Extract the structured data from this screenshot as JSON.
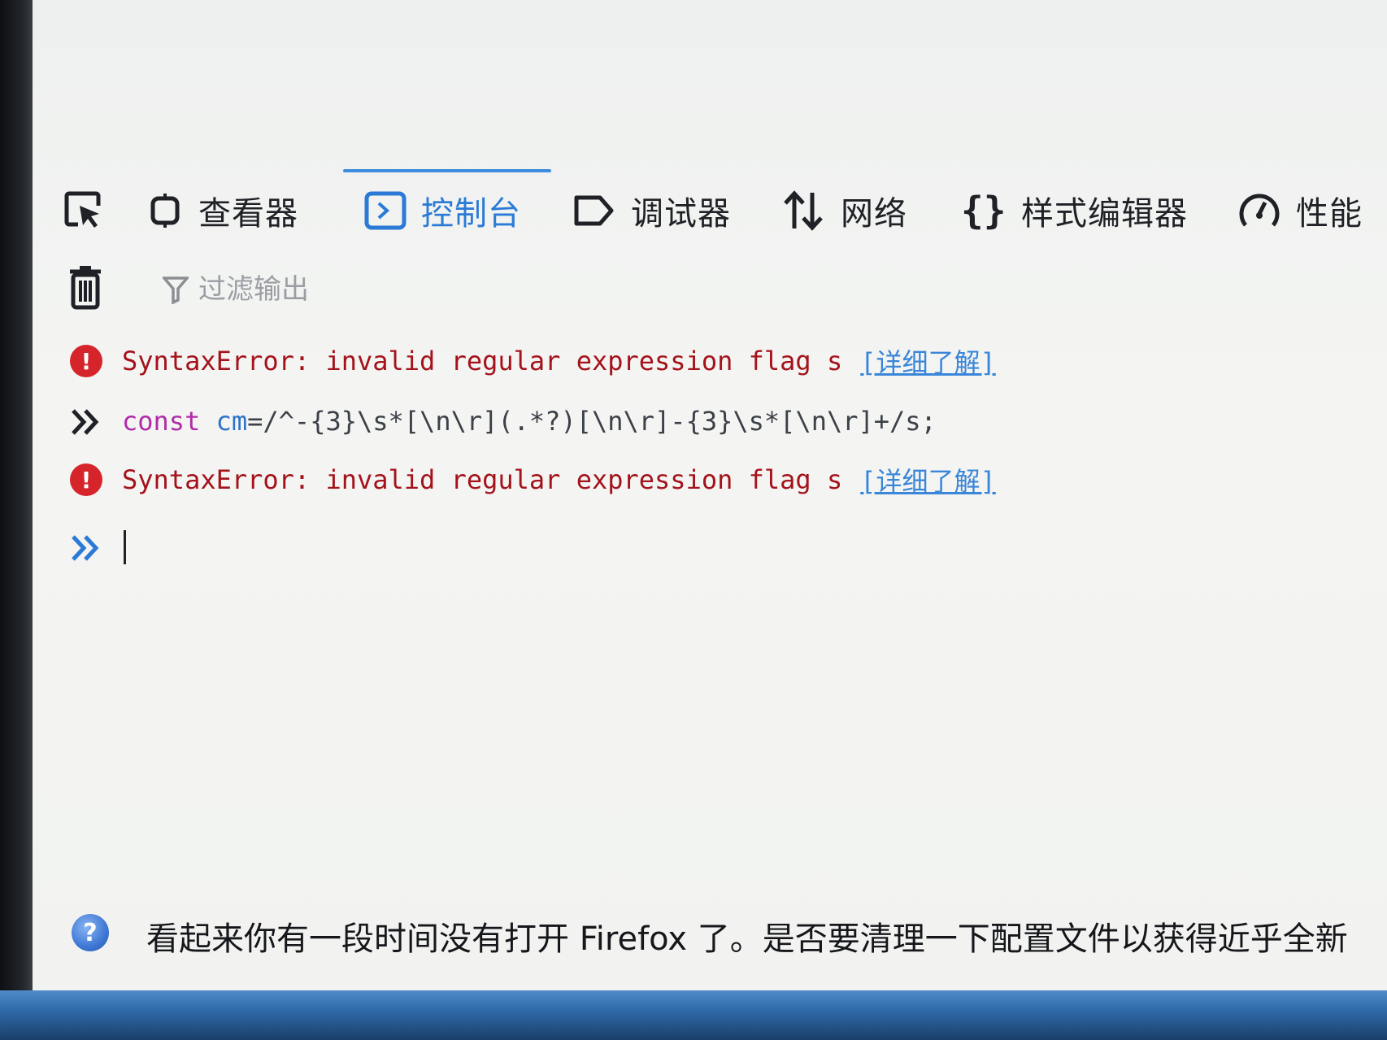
{
  "toolbar": {
    "tabs": [
      {
        "label": "查看器",
        "icon": "inspector-icon"
      },
      {
        "label": "控制台",
        "icon": "console-icon",
        "selected": true
      },
      {
        "label": "调试器",
        "icon": "debugger-icon"
      },
      {
        "label": "网络",
        "icon": "network-icon"
      },
      {
        "label": "样式编辑器",
        "icon": "style-editor-icon"
      },
      {
        "label": "性能",
        "icon": "performance-icon"
      }
    ]
  },
  "filter": {
    "placeholder": "过滤输出"
  },
  "console": {
    "messages": [
      {
        "type": "error",
        "text": "SyntaxError: invalid regular expression flag s",
        "link": "[详细了解]"
      },
      {
        "type": "input",
        "keyword": "const",
        "variable": "cm",
        "rest": "=/^-{3}\\s*[\\n\\r](.*?)[\\n\\r]-{3}\\s*[\\n\\r]+/s;"
      },
      {
        "type": "error",
        "text": "SyntaxError: invalid regular expression flag s",
        "link": "[详细了解]"
      }
    ],
    "prompt_value": ""
  },
  "notification": {
    "text": "看起来你有一段时间没有打开 Firefox 了。是否要清理一下配置文件以获得近乎全新"
  },
  "colors": {
    "accent": "#2b7ad6",
    "error": "#a4121b",
    "error_icon": "#d6242b",
    "keyword": "#b12ca8"
  }
}
